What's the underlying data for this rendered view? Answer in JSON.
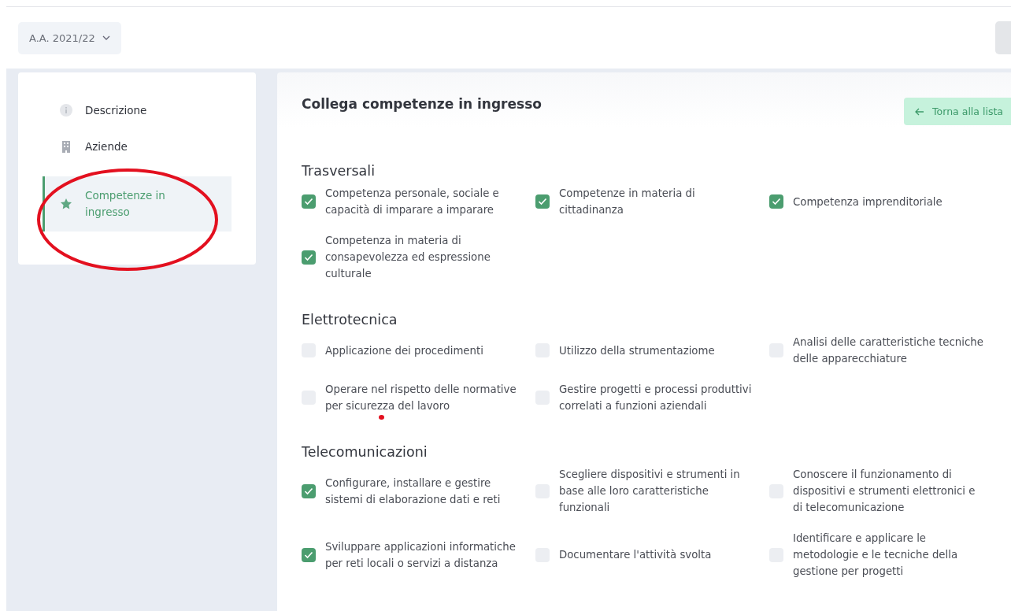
{
  "year_selector": {
    "value": "A.A. 2021/22"
  },
  "sidebar": {
    "items": [
      {
        "label": "Descrizione",
        "selected": false
      },
      {
        "label": "Aziende",
        "selected": false
      },
      {
        "label": "Competenze in ingresso",
        "selected": true
      }
    ]
  },
  "main": {
    "title": "Collega competenze in ingresso",
    "back_button": "Torna alla lista",
    "sections": [
      {
        "title": "Trasversali",
        "items": [
          {
            "label": "Competenza personale, sociale e capacità di imparare a imparare",
            "checked": true
          },
          {
            "label": "Competenze in materia di cittadinanza",
            "checked": true
          },
          {
            "label": "Competenza imprenditoriale",
            "checked": true
          },
          {
            "label": "Competenza in materia di consapevolezza ed espressione culturale",
            "checked": true
          }
        ]
      },
      {
        "title": "Elettrotecnica",
        "items": [
          {
            "label": "Applicazione dei procedimenti",
            "checked": false
          },
          {
            "label": "Utilizzo della strumentaziome",
            "checked": false
          },
          {
            "label": "Analisi delle caratteristiche tecniche delle apparecchiature",
            "checked": false
          },
          {
            "label": "Operare nel rispetto delle normative per sicurezza del lavoro",
            "checked": false
          },
          {
            "label": "Gestire progetti e processi produttivi correlati a funzioni aziendali",
            "checked": false
          }
        ]
      },
      {
        "title": "Telecomunicazioni",
        "items": [
          {
            "label": "Configurare, installare e gestire sistemi di elaborazione dati e reti",
            "checked": true
          },
          {
            "label": "Scegliere dispositivi e strumenti in base alle loro caratteristiche funzionali",
            "checked": false
          },
          {
            "label": "Conoscere il funzionamento di dispositivi e strumenti elettronici e di telecomunicazione",
            "checked": false
          },
          {
            "label": "Sviluppare applicazioni informatiche per reti locali o servizi a distanza",
            "checked": true
          },
          {
            "label": "Documentare l'attività svolta",
            "checked": false
          },
          {
            "label": "Identificare e applicare le metodologie e le tecniche della gestione per progetti",
            "checked": false
          }
        ]
      }
    ]
  }
}
